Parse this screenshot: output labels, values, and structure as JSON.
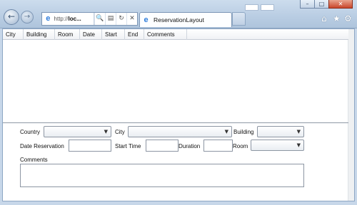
{
  "browser": {
    "address_prefix": "http://",
    "address_rest": "loc...",
    "tab_title": "ReservationLayout",
    "window_controls": {
      "minimize": "–",
      "maximize": "□",
      "close": "✕"
    },
    "nav": {
      "back": "←",
      "forward": "→"
    },
    "address_tools": {
      "search": "🔍",
      "compat": "▤",
      "refresh": "↻",
      "stop": "✕"
    },
    "toolbar_icons": {
      "home": "⌂",
      "favorites": "★",
      "tools": "⚙"
    }
  },
  "grid": {
    "columns": [
      "City",
      "Building",
      "Room",
      "Date",
      "Start",
      "End",
      "Comments"
    ]
  },
  "form": {
    "country_label": "Country",
    "city_label": "City",
    "building_label": "Building",
    "date_reservation_label": "Date Reservation",
    "start_time_label": "Start Time",
    "duration_label": "Duration",
    "room_label": "Room",
    "comments_label": "Comments",
    "dropdown_arrow": "▼"
  }
}
